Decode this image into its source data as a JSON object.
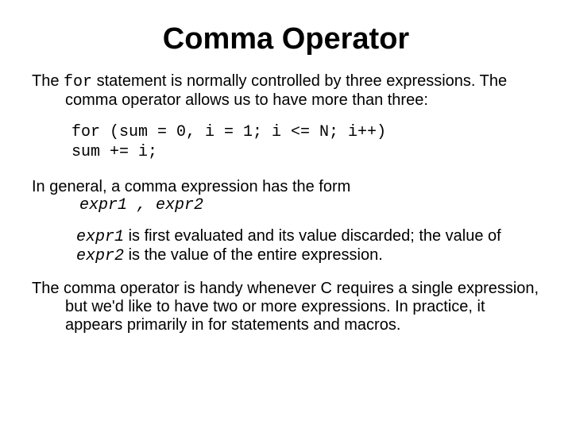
{
  "title": "Comma Operator",
  "p1_a": "The ",
  "p1_for": "for",
  "p1_b": " statement is normally controlled by three expressions. The comma operator allows us to have more than three:",
  "code": "for (sum = 0, i = 1; i <= N; i++)\nsum += i;",
  "p2_lead": "In general, a comma expression has the form",
  "p2_form": "expr1 , expr2",
  "p3_a": "expr1",
  "p3_b": " is first evaluated and its value discarded; the value of ",
  "p3_c": "expr2",
  "p3_d": " is the value of the entire expression.",
  "p4": "The comma operator is handy whenever C requires a single expression, but we'd like to have two or more expressions. In practice, it appears primarily in for statements and macros."
}
